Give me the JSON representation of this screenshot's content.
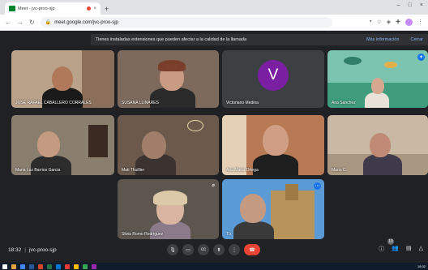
{
  "browser": {
    "tab_title": "Meet - jvc-proo-sjp",
    "tab_close": "×",
    "new_tab": "+",
    "url": "meet.google.com/jvc-proo-sjp",
    "window_controls": [
      "–",
      "□",
      "×"
    ]
  },
  "banner": {
    "message": "Tienes instaladas extensiones que pueden afectar a la calidad de la llamada",
    "more_info": "Más información",
    "close": "Cerrar"
  },
  "participants": [
    {
      "name": "JOSÉ RAFAEL CABALLERO CORRALES"
    },
    {
      "name": "SUSANA LLINARES"
    },
    {
      "name": "Victoriano Medina",
      "initial": "V"
    },
    {
      "name": "Ana Sánchez"
    },
    {
      "name": "Maria Luz Barrios Garcia"
    },
    {
      "name": "Mati Thuillier"
    },
    {
      "name": "Ana María Ortega"
    },
    {
      "name": "Mario C."
    },
    {
      "name": "Silvia Romo Rodríguez"
    },
    {
      "name": "Tú"
    }
  ],
  "bottom_bar": {
    "time": "18:32",
    "separator": "|",
    "meeting_code": "jvc-proo-sjp",
    "participant_count": "10"
  },
  "taskbar": {
    "clock": "18:32"
  },
  "colors": {
    "meet_bg": "#202124",
    "hangup": "#ea4335",
    "avatar": "#7b1fa2",
    "link": "#8ab4f8"
  }
}
